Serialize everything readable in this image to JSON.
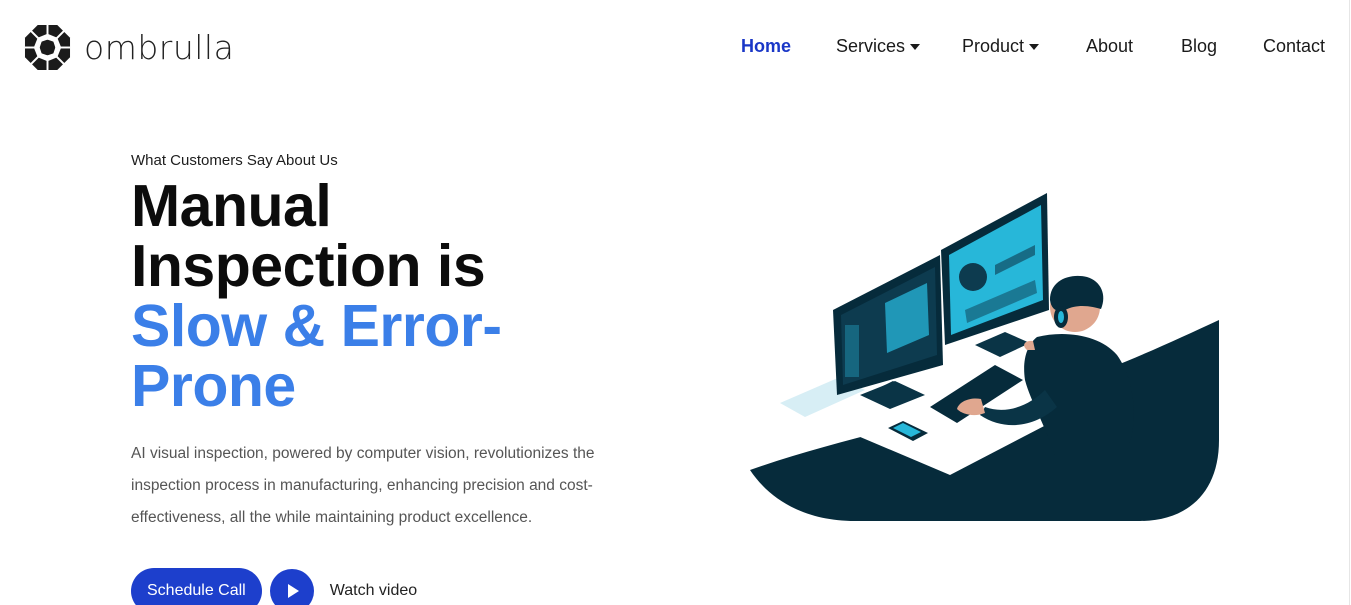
{
  "brand": {
    "name": "ombrulla"
  },
  "nav": {
    "items": [
      {
        "label": "Home",
        "active": true,
        "dropdown": false
      },
      {
        "label": "Services",
        "active": false,
        "dropdown": true
      },
      {
        "label": "Product",
        "active": false,
        "dropdown": true
      },
      {
        "label": "About",
        "active": false,
        "dropdown": false
      },
      {
        "label": "Blog",
        "active": false,
        "dropdown": false
      },
      {
        "label": "Contact",
        "active": false,
        "dropdown": false
      }
    ]
  },
  "hero": {
    "eyebrow": "What Customers Say About Us",
    "headline_line1": "Manual",
    "headline_line2": "Inspection is",
    "headline_highlight_line1": "Slow & Error-",
    "headline_highlight_line2": "Prone",
    "description": "AI visual inspection, powered by computer vision, revolutionizes the inspection process in manufacturing, enhancing precision and cost-effectiveness, all the while maintaining product excellence.",
    "primary_button": "Schedule Call",
    "video_link": "Watch video"
  },
  "colors": {
    "accent": "#1d3fcc",
    "highlight": "#3b7fe8",
    "active_nav": "#1a37c7",
    "illustration_dark": "#062b3b",
    "illustration_cyan": "#27b7d9"
  },
  "icons": {
    "logo": "octagon-aperture-logo",
    "play": "play-icon",
    "dropdown": "caret-down-icon"
  }
}
